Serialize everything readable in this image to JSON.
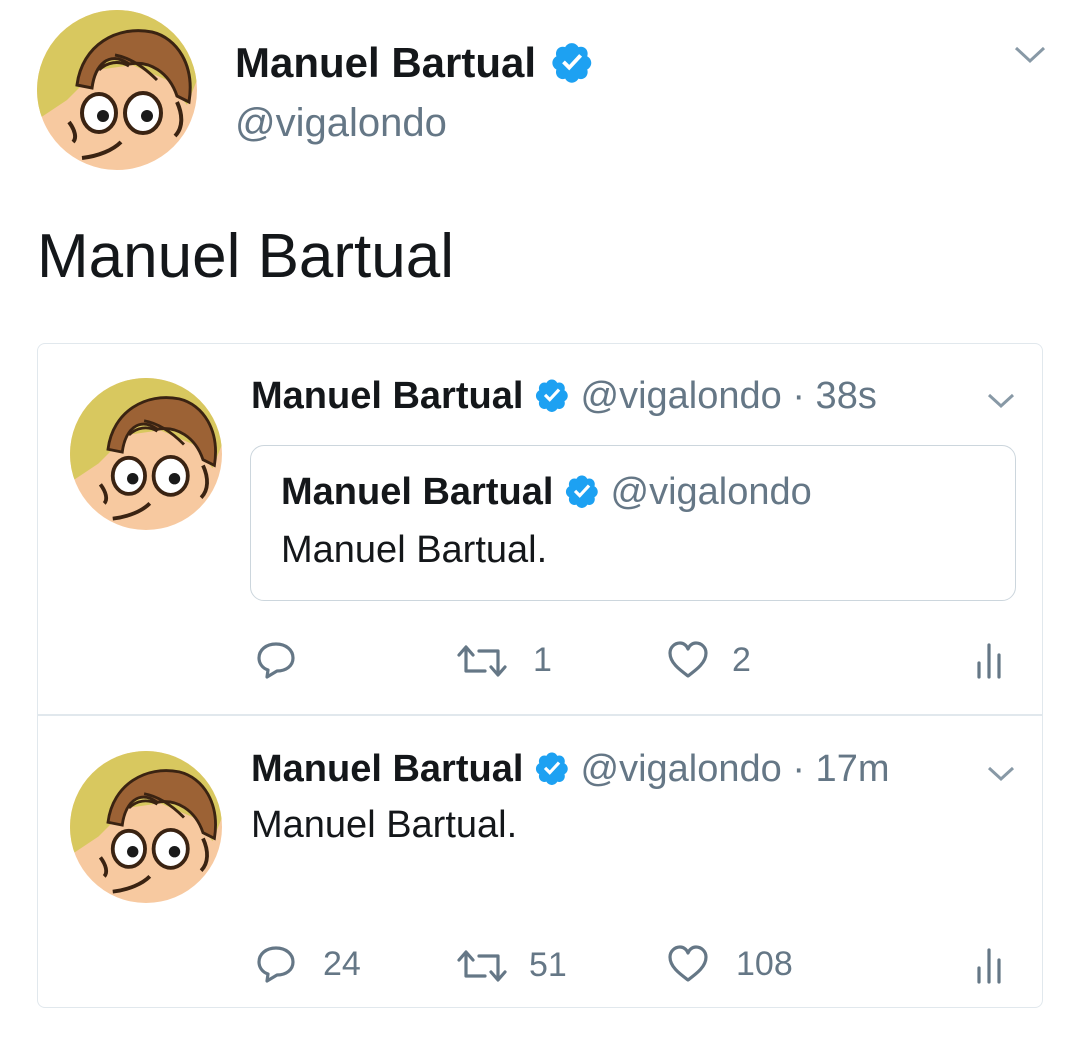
{
  "header": {
    "name": "Manuel Bartual",
    "handle": "@vigalondo",
    "tweet_text": "Manuel Bartual"
  },
  "tweets": [
    {
      "name": "Manuel Bartual",
      "handle": "@vigalondo",
      "time": "· 38s",
      "quoted": {
        "name": "Manuel Bartual",
        "handle": "@vigalondo",
        "text": "Manuel Bartual."
      },
      "replies": "",
      "retweets": "1",
      "likes": "2"
    },
    {
      "name": "Manuel Bartual",
      "handle": "@vigalondo",
      "time": "· 17m",
      "text": "Manuel Bartual.",
      "replies": "24",
      "retweets": "51",
      "likes": "108"
    }
  ],
  "colors": {
    "verified": "#1da1f2",
    "text": "#14171a",
    "secondary": "#657786",
    "border": "#e1e8ed"
  },
  "icons": [
    "avatar-illustration",
    "verified-badge-icon",
    "chevron-down-icon",
    "reply-icon",
    "retweet-icon",
    "like-icon",
    "analytics-icon"
  ]
}
